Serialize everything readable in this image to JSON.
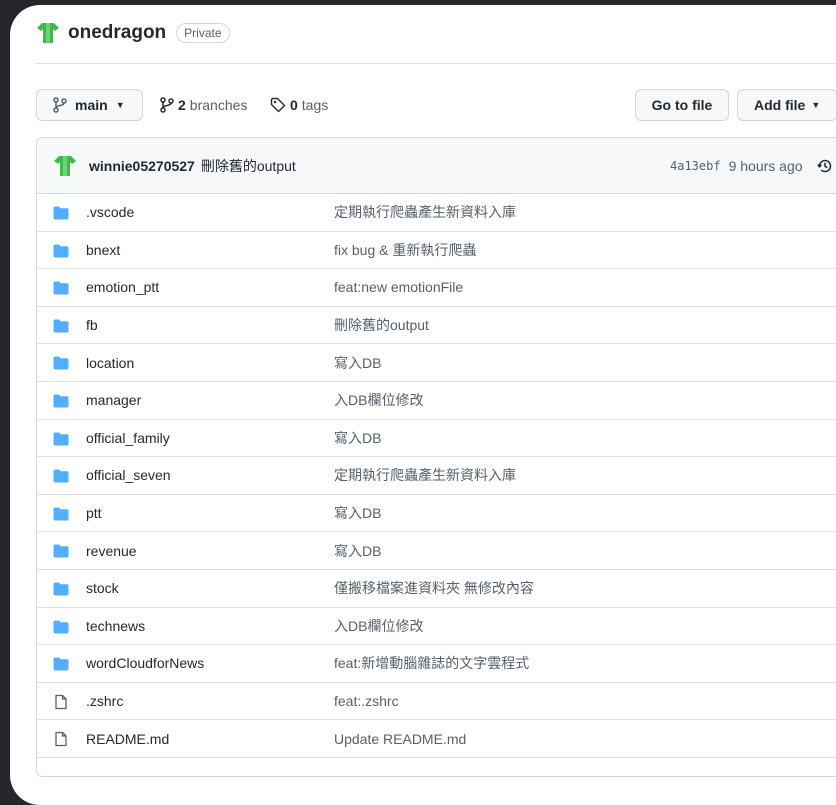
{
  "repo": {
    "name": "onedragon",
    "visibility": "Private"
  },
  "toolbar": {
    "branch_label": "main",
    "branches_count": "2",
    "branches_label": "branches",
    "tags_count": "0",
    "tags_label": "tags",
    "go_to_file": "Go to file",
    "add_file": "Add file"
  },
  "commit": {
    "author": "winnie05270527",
    "message": "刪除舊的output",
    "sha": "4a13ebf",
    "time": "9 hours ago"
  },
  "files": [
    {
      "type": "folder",
      "name": ".vscode",
      "message": "定期執行爬蟲產生新資料入庫"
    },
    {
      "type": "folder",
      "name": "bnext",
      "message": "fix bug & 重新執行爬蟲"
    },
    {
      "type": "folder",
      "name": "emotion_ptt",
      "message": "feat:new emotionFile"
    },
    {
      "type": "folder",
      "name": "fb",
      "message": "刪除舊的output"
    },
    {
      "type": "folder",
      "name": "location",
      "message": "寫入DB"
    },
    {
      "type": "folder",
      "name": "manager",
      "message": "入DB欄位修改"
    },
    {
      "type": "folder",
      "name": "official_family",
      "message": "寫入DB"
    },
    {
      "type": "folder",
      "name": "official_seven",
      "message": "定期執行爬蟲產生新資料入庫"
    },
    {
      "type": "folder",
      "name": "ptt",
      "message": "寫入DB"
    },
    {
      "type": "folder",
      "name": "revenue",
      "message": "寫入DB"
    },
    {
      "type": "folder",
      "name": "stock",
      "message": "僅搬移檔案進資料夾 無修改內容"
    },
    {
      "type": "folder",
      "name": "technews",
      "message": "入DB欄位修改"
    },
    {
      "type": "folder",
      "name": "wordCloudforNews",
      "message": "feat:新增動腦雜誌的文字雲程式"
    },
    {
      "type": "file",
      "name": ".zshrc",
      "message": "feat:.zshrc"
    },
    {
      "type": "file",
      "name": "README.md",
      "message": "Update README.md"
    }
  ],
  "colors": {
    "folder": "#54aeff",
    "avatar": "#3fb950",
    "accent": "#24292f",
    "muted": "#57606a"
  }
}
